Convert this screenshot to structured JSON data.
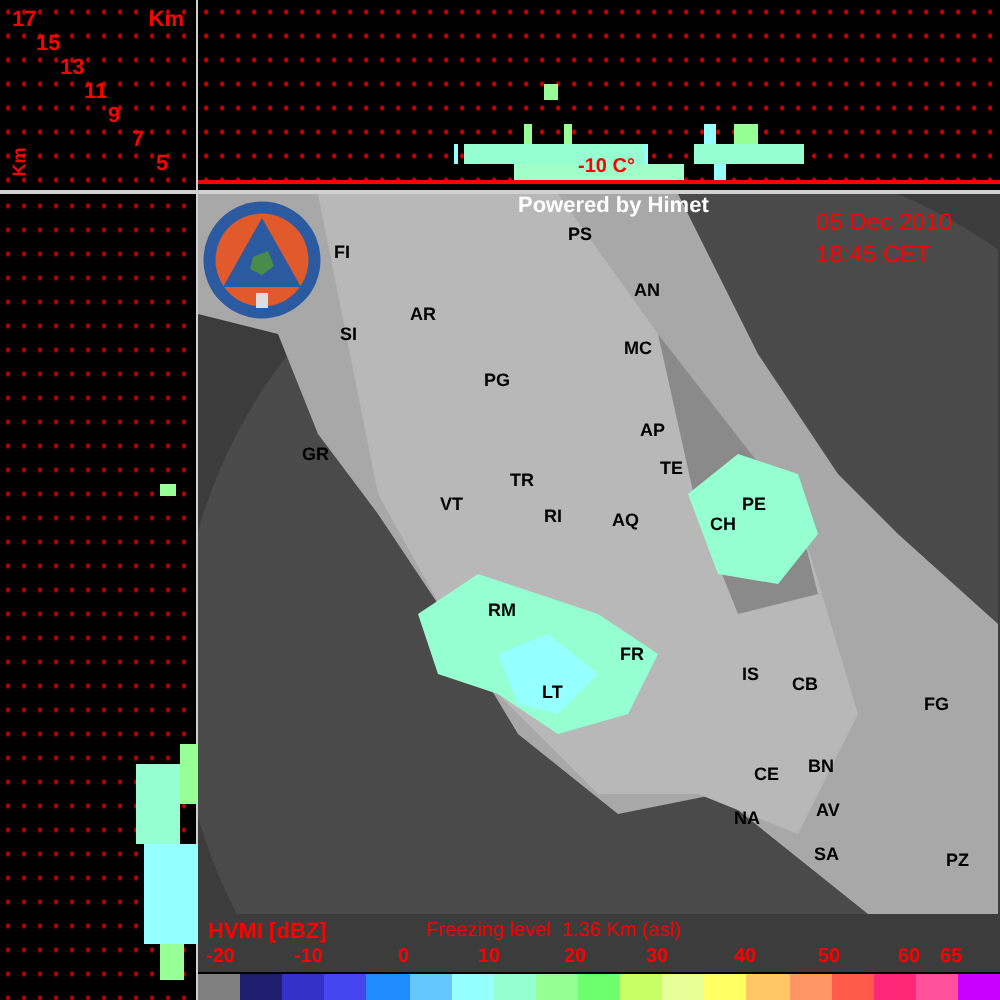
{
  "height_scale": {
    "unit": "Km",
    "levels": [
      "17",
      "15",
      "13",
      "11",
      "9",
      "7",
      "5"
    ],
    "axis_label": "Km"
  },
  "cross_section": {
    "isotherm_label": "-10 C°"
  },
  "map": {
    "credit": "Powered by Himet",
    "date": "05 Dec 2010",
    "time": "18:45 CET",
    "cities": [
      {
        "label": "FI"
      },
      {
        "label": "SI"
      },
      {
        "label": "AR"
      },
      {
        "label": "PS"
      },
      {
        "label": "AN"
      },
      {
        "label": "MC"
      },
      {
        "label": "PG"
      },
      {
        "label": "GR"
      },
      {
        "label": "AP"
      },
      {
        "label": "TE"
      },
      {
        "label": "TR"
      },
      {
        "label": "VT"
      },
      {
        "label": "RI"
      },
      {
        "label": "AQ"
      },
      {
        "label": "PE"
      },
      {
        "label": "CH"
      },
      {
        "label": "RM"
      },
      {
        "label": "FR"
      },
      {
        "label": "LT"
      },
      {
        "label": "IS"
      },
      {
        "label": "CB"
      },
      {
        "label": "FG"
      },
      {
        "label": "CE"
      },
      {
        "label": "BN"
      },
      {
        "label": "AV"
      },
      {
        "label": "NA"
      },
      {
        "label": "SA"
      },
      {
        "label": "PZ"
      }
    ]
  },
  "legend": {
    "product": "HVMI [dBZ]",
    "freezing_level": "Freezing level  1.36 Km (asl)",
    "ticks": [
      "-20",
      "-10",
      "0",
      "10",
      "20",
      "30",
      "40",
      "50",
      "60",
      "65"
    ],
    "bins": [
      {
        "color": "#808080"
      },
      {
        "color": "#1e1e6e"
      },
      {
        "color": "#3232c8"
      },
      {
        "color": "#4646f0"
      },
      {
        "color": "#1e8cff"
      },
      {
        "color": "#64c8ff"
      },
      {
        "color": "#96ffff"
      },
      {
        "color": "#96ffd2"
      },
      {
        "color": "#96ff96"
      },
      {
        "color": "#6eff6e"
      },
      {
        "color": "#c8ff64"
      },
      {
        "color": "#e6ff96"
      },
      {
        "color": "#ffff64"
      },
      {
        "color": "#ffc864"
      },
      {
        "color": "#ff9664"
      },
      {
        "color": "#ff5a4b"
      },
      {
        "color": "#ff2878"
      },
      {
        "color": "#ff509b"
      },
      {
        "color": "#c800ff"
      }
    ]
  }
}
